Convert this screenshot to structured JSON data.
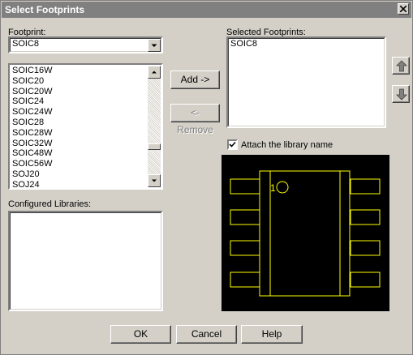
{
  "window": {
    "title": "Select Footprints"
  },
  "footprint": {
    "label": "Footprint:",
    "value": "SOIC8"
  },
  "footprint_list": {
    "items": [
      "SOIC16W",
      "SOIC20",
      "SOIC20W",
      "SOIC24",
      "SOIC24W",
      "SOIC28",
      "SOIC28W",
      "SOIC32W",
      "SOIC48W",
      "SOIC56W",
      "SOJ20",
      "SOJ24"
    ]
  },
  "configured_libraries": {
    "label": "Configured Libraries:",
    "items": []
  },
  "buttons": {
    "add": "Add ->",
    "remove": "<- Remove",
    "ok": "OK",
    "cancel": "Cancel",
    "help": "Help"
  },
  "selected_footprints": {
    "label": "Selected Footprints:",
    "items": [
      "SOIC8"
    ]
  },
  "attach_library": {
    "label": "Attach the library name",
    "checked": true
  },
  "preview": {
    "pin1_label": "1",
    "color": "#ffff00",
    "background": "#000000"
  }
}
